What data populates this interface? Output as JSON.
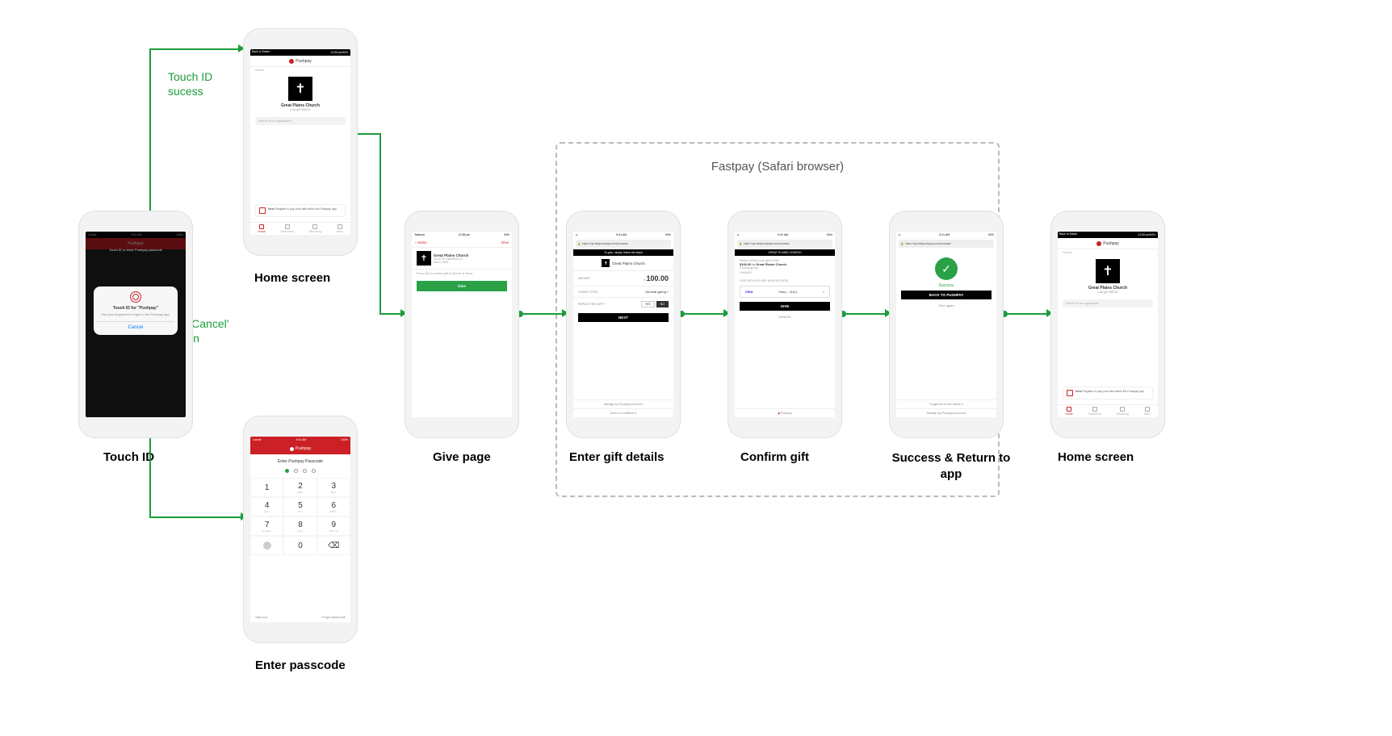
{
  "captions": {
    "touch_id": "Touch ID",
    "home_screen_1": "Home screen",
    "enter_passcode": "Enter passcode",
    "give_page": "Give page",
    "enter_gift": "Enter gift details",
    "confirm_gift": "Confirm gift",
    "success_return": "Success & Return to app",
    "home_screen_2": "Home screen"
  },
  "labels": {
    "touchid_success": "Touch ID\nsucess",
    "tap_cancel": "Tap 'Cancel'\nbutton"
  },
  "group": {
    "title": "Fastpay (Safari browser)"
  },
  "app": {
    "brand": "Pushpay",
    "org_name": "Great Plains Church",
    "org_addr": "23 19 St, Lawrence KS",
    "org_code": "MOLL-EKB",
    "last_gift": "Last gift: $58.00",
    "recent_label": "Recent",
    "search_placeholder": "Search for an organisation",
    "notice_strong": "New!",
    "notice_text": "Register to pay your bills within the Pushpay app.",
    "tabs": [
      "Home",
      "Favourites",
      "Recurring",
      "More"
    ]
  },
  "touchid": {
    "prompt_behind": "Touch ID or enter Pushpay passcode",
    "title": "Touch ID for \"Pushpay\"",
    "subtitle": "Use your fingerprint to login to the Pushpay app.",
    "cancel": "Cancel"
  },
  "passcode": {
    "header": "Pushpay",
    "prompt": "Enter Pushpay Passcode",
    "keys": [
      {
        "n": "1",
        "s": ""
      },
      {
        "n": "2",
        "s": "ABC"
      },
      {
        "n": "3",
        "s": "DEF"
      },
      {
        "n": "4",
        "s": "GHI"
      },
      {
        "n": "5",
        "s": "JKL"
      },
      {
        "n": "6",
        "s": "MNO"
      },
      {
        "n": "7",
        "s": "PQRS"
      },
      {
        "n": "8",
        "s": "TUV"
      },
      {
        "n": "9",
        "s": "WXYZ"
      },
      {
        "n": "",
        "s": ""
      },
      {
        "n": "0",
        "s": ""
      },
      {
        "n": "⌫",
        "s": ""
      }
    ],
    "sign_out": "Sign out",
    "forgot": "Forgot passcode"
  },
  "give": {
    "back": "Home",
    "action": "Give",
    "hint": "Press Give to make a gift to Church of Jesus",
    "button": "Give"
  },
  "fastpay": {
    "url": "https://qa.testpushpay.com/p/mosaic",
    "step_banner": "To give, simply follow the steps",
    "amount_label": "AMOUNT",
    "currency": "$",
    "amount": "100.00",
    "types_label": "GIVING TYPES",
    "type_value": "General giving",
    "repeat_label": "REPEAT THIS GIFT?",
    "yes": "YES",
    "no": "NO",
    "next": "NEXT",
    "manage": "Manage my Pushpay account",
    "terms": "Terms & Conditions",
    "org_banner": "GREAT PLAINS CHURCH",
    "confirm_l1": "Please confirm your gift of USD",
    "confirm_amount": "$100.00",
    "confirm_to": "to",
    "confirm_sub": "General giving",
    "change": "CHANGE",
    "give_with": "GIVE WITH (OR ADD NEW METHOD)",
    "card": "Visa (...1111)",
    "give_btn": "GIVE",
    "cancel": "CANCEL",
    "success": "Success",
    "back_app": "BACK TO PUSHPAY",
    "give_again": "Give again",
    "forget": "Forget me on this device"
  },
  "status": {
    "carrier": "Carrier",
    "time": "9:41 AM",
    "alt_carrier": "Telecom",
    "alt_time": "12:55 pm",
    "back_safari": "Back to Safari",
    "battery": "100%",
    "alt_battery": "94%"
  }
}
